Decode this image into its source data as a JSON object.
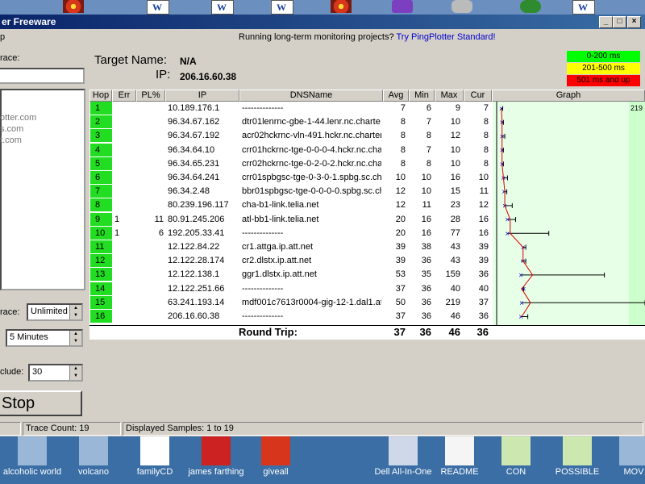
{
  "window": {
    "title": "er Freeware"
  },
  "menu": {
    "visible_item": "p"
  },
  "promo": {
    "text": "Running long-term monitoring projects?",
    "link": "Try PingPlotter Standard!"
  },
  "left": {
    "trace_label": "race:",
    "url_items": [
      "otter.com",
      "s.com",
      "t.com"
    ],
    "interval_label": "race:",
    "interval_value": "Unlimited",
    "samples_value": "5 Minutes",
    "include_label": "clude:",
    "include_value": "30",
    "stop_label": "Stop"
  },
  "target": {
    "name_label": "Target Name:",
    "name_value": "N/A",
    "ip_label": "IP:",
    "ip_value": "206.16.60.38"
  },
  "legend": [
    {
      "label": "0-200 ms",
      "color": "#00ff00"
    },
    {
      "label": "201-500 ms",
      "color": "#ffff00"
    },
    {
      "label": "501 ms and up",
      "color": "#ff0000"
    }
  ],
  "columns": [
    "Hop",
    "Err",
    "PL%",
    "IP",
    "DNSName",
    "Avg",
    "Min",
    "Max",
    "Cur",
    "Graph"
  ],
  "graph_max_label": "219",
  "rows": [
    {
      "hop": "1",
      "err": "",
      "pl": "",
      "ip": "10.189.176.1",
      "dns": "--------------",
      "avg": "7",
      "min": "6",
      "max": "9",
      "cur": "7"
    },
    {
      "hop": "2",
      "err": "",
      "pl": "",
      "ip": "96.34.67.162",
      "dns": "dtr01lenrnc-gbe-1-44.lenr.nc.charte",
      "avg": "8",
      "min": "7",
      "max": "10",
      "cur": "8"
    },
    {
      "hop": "3",
      "err": "",
      "pl": "",
      "ip": "96.34.67.192",
      "dns": "acr02hckrnc-vln-491.hckr.nc.charter",
      "avg": "8",
      "min": "8",
      "max": "12",
      "cur": "8"
    },
    {
      "hop": "4",
      "err": "",
      "pl": "",
      "ip": "96.34.64.10",
      "dns": "crr01hckrnc-tge-0-0-0-4.hckr.nc.cha",
      "avg": "8",
      "min": "7",
      "max": "10",
      "cur": "8"
    },
    {
      "hop": "5",
      "err": "",
      "pl": "",
      "ip": "96.34.65.231",
      "dns": "crr02hckrnc-tge-0-2-0-2.hckr.nc.cha",
      "avg": "8",
      "min": "8",
      "max": "10",
      "cur": "8"
    },
    {
      "hop": "6",
      "err": "",
      "pl": "",
      "ip": "96.34.64.241",
      "dns": "crr01spbgsc-tge-0-3-0-1.spbg.sc.ch",
      "avg": "10",
      "min": "10",
      "max": "16",
      "cur": "10"
    },
    {
      "hop": "7",
      "err": "",
      "pl": "",
      "ip": "96.34.2.48",
      "dns": "bbr01spbgsc-tge-0-0-0-0.spbg.sc.ch",
      "avg": "12",
      "min": "10",
      "max": "15",
      "cur": "11"
    },
    {
      "hop": "8",
      "err": "",
      "pl": "",
      "ip": "80.239.196.117",
      "dns": "cha-b1-link.telia.net",
      "avg": "12",
      "min": "11",
      "max": "23",
      "cur": "12"
    },
    {
      "hop": "9",
      "err": "1",
      "pl": "11",
      "ip": "80.91.245.206",
      "dns": "atl-bb1-link.telia.net",
      "avg": "20",
      "min": "16",
      "max": "28",
      "cur": "16"
    },
    {
      "hop": "10",
      "err": "1",
      "pl": "6",
      "ip": "192.205.33.41",
      "dns": "--------------",
      "avg": "20",
      "min": "16",
      "max": "77",
      "cur": "16"
    },
    {
      "hop": "11",
      "err": "",
      "pl": "",
      "ip": "12.122.84.22",
      "dns": "cr1.attga.ip.att.net",
      "avg": "39",
      "min": "38",
      "max": "43",
      "cur": "39"
    },
    {
      "hop": "12",
      "err": "",
      "pl": "",
      "ip": "12.122.28.174",
      "dns": "cr2.dlstx.ip.att.net",
      "avg": "39",
      "min": "36",
      "max": "43",
      "cur": "39"
    },
    {
      "hop": "13",
      "err": "",
      "pl": "",
      "ip": "12.122.138.1",
      "dns": "ggr1.dlstx.ip.att.net",
      "avg": "53",
      "min": "35",
      "max": "159",
      "cur": "36"
    },
    {
      "hop": "14",
      "err": "",
      "pl": "",
      "ip": "12.122.251.66",
      "dns": "--------------",
      "avg": "37",
      "min": "36",
      "max": "40",
      "cur": "40"
    },
    {
      "hop": "15",
      "err": "",
      "pl": "",
      "ip": "63.241.193.14",
      "dns": "mdf001c7613r0004-gig-12-1.dal1.at",
      "avg": "50",
      "min": "36",
      "max": "219",
      "cur": "37"
    },
    {
      "hop": "16",
      "err": "",
      "pl": "",
      "ip": "206.16.60.38",
      "dns": "--------------",
      "avg": "37",
      "min": "36",
      "max": "46",
      "cur": "36"
    }
  ],
  "round_trip": {
    "label": "Round Trip:",
    "avg": "37",
    "min": "36",
    "max": "46",
    "cur": "36"
  },
  "status": {
    "cell1": "",
    "trace_count": "Trace Count: 19",
    "samples": "Displayed Samples: 1 to 19"
  },
  "desktop_icons": [
    {
      "label": "alcoholic world",
      "icon": "image-icon"
    },
    {
      "label": "volcano",
      "icon": "image-icon"
    },
    {
      "label": "familyCD",
      "icon": "word-doc-icon"
    },
    {
      "label": "james farthing",
      "icon": "pdf-icon"
    },
    {
      "label": "giveall",
      "icon": "flower-icon"
    },
    {
      "label": "Dell All-In-One",
      "icon": "dell-aio-icon"
    },
    {
      "label": "README",
      "icon": "text-doc-icon"
    },
    {
      "label": "CON",
      "icon": "spreadsheet-icon"
    },
    {
      "label": "POSSIBLE",
      "icon": "spreadsheet-icon"
    },
    {
      "label": "MOV",
      "icon": "shortcut-icon"
    }
  ]
}
